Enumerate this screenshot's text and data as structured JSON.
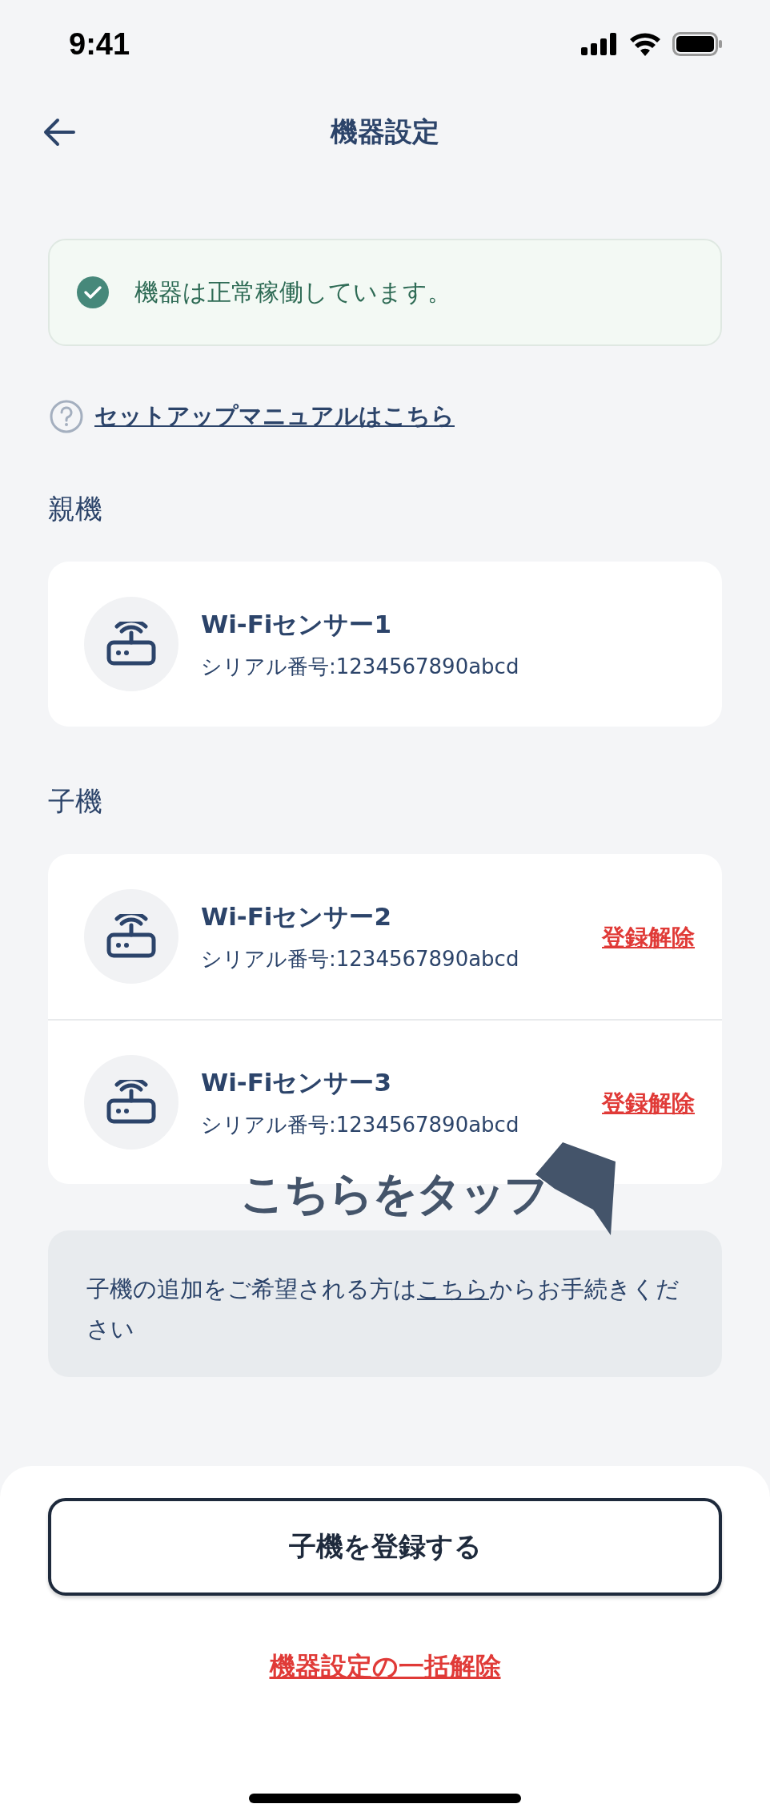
{
  "status_bar": {
    "time": "9:41"
  },
  "header": {
    "title": "機器設定"
  },
  "status_banner": {
    "message": "機器は正常稼働しています。"
  },
  "manual_link": {
    "label": "セットアップマニュアルはこちら"
  },
  "sections": [
    {
      "heading": "親機",
      "devices": [
        {
          "name": "Wi-Fiセンサー1",
          "serial": "シリアル番号:1234567890abcd"
        }
      ]
    },
    {
      "heading": "子機",
      "devices": [
        {
          "name": "Wi-Fiセンサー2",
          "serial": "シリアル番号:1234567890abcd",
          "action": "登録解除"
        },
        {
          "name": "Wi-Fiセンサー3",
          "serial": "シリアル番号:1234567890abcd",
          "action": "登録解除"
        }
      ]
    }
  ],
  "annotation": {
    "text": "こちらをタップ"
  },
  "info_note": {
    "parts": [
      {
        "kind": "text",
        "text": "子機の追加をご希望される方は"
      },
      {
        "kind": "link",
        "text": "こちら"
      },
      {
        "kind": "text",
        "text": "からお手続きください"
      }
    ]
  },
  "register_button": {
    "label": "子機を登録する"
  },
  "bulk_unregister_link": {
    "label": "機器設定の一括解除"
  }
}
